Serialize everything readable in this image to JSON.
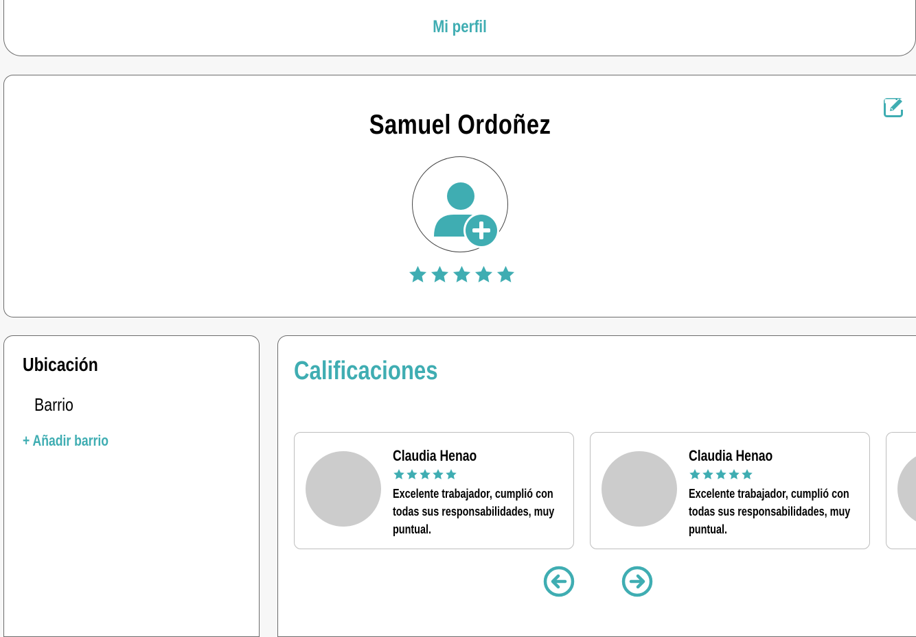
{
  "colors": {
    "accent": "#3fadb2",
    "avatar_placeholder": "#cccccc",
    "border": "#6b6b6b"
  },
  "header": {
    "title": "Mi perfil"
  },
  "profile": {
    "name": "Samuel Ordoñez",
    "avatar_icon": "user-plus-icon",
    "edit_icon": "edit-icon",
    "rating_stars": 5
  },
  "location": {
    "title": "Ubicación",
    "barrio": "Barrio",
    "add_barrio": "+ Añadir barrio"
  },
  "ratings": {
    "title": "Calificaciones",
    "reviews": [
      {
        "name": "Claudia Henao",
        "stars": 5,
        "text": "Excelente trabajador, cumplió con todas sus responsabilidades, muy puntual."
      },
      {
        "name": "Claudia Henao",
        "stars": 5,
        "text": "Excelente trabajador, cumplió con todas sus responsabilidades, muy puntual."
      }
    ],
    "prev_icon": "arrow-left-circle-icon",
    "next_icon": "arrow-right-circle-icon"
  }
}
